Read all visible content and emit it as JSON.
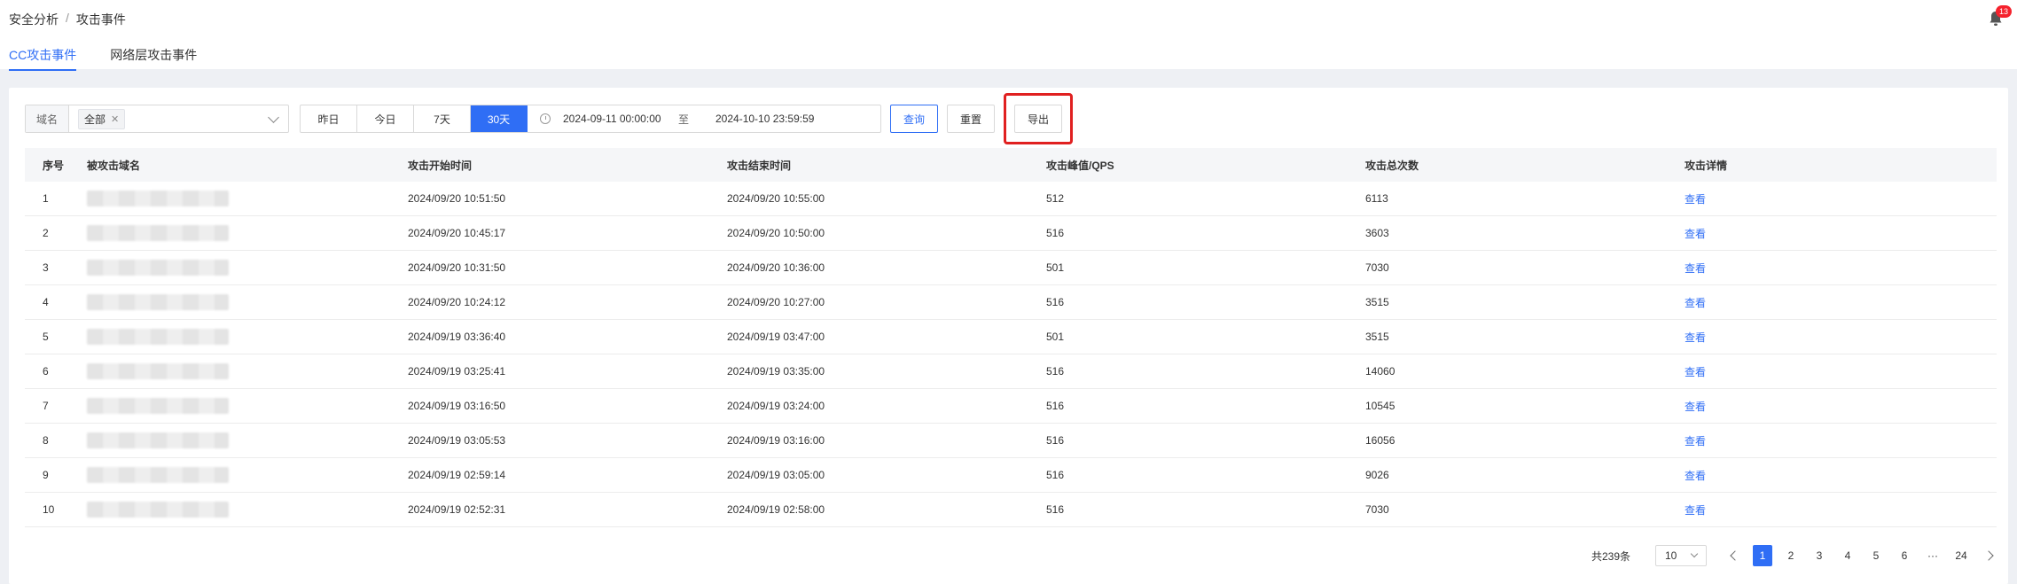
{
  "breadcrumb": {
    "parent": "安全分析",
    "separator": "/",
    "current": "攻击事件"
  },
  "notification": {
    "badge": "13"
  },
  "tabs": [
    {
      "label": "CC攻击事件",
      "active": true
    },
    {
      "label": "网络层攻击事件",
      "active": false
    }
  ],
  "filter": {
    "domain_label": "域名",
    "domain_tag": "全部",
    "range_buttons": [
      {
        "label": "昨日",
        "active": false
      },
      {
        "label": "今日",
        "active": false
      },
      {
        "label": "7天",
        "active": false
      },
      {
        "label": "30天",
        "active": true
      }
    ],
    "date_start": "2024-09-11 00:00:00",
    "date_sep": "至",
    "date_end": "2024-10-10 23:59:59",
    "query_label": "查询",
    "reset_label": "重置",
    "export_label": "导出"
  },
  "table": {
    "columns": [
      "序号",
      "被攻击域名",
      "攻击开始时间",
      "攻击结束时间",
      "攻击峰值/QPS",
      "攻击总次数",
      "攻击详情"
    ],
    "link_label": "查看",
    "rows": [
      {
        "no": "1",
        "start": "2024/09/20 10:51:50",
        "end": "2024/09/20 10:55:00",
        "peak": "512",
        "total": "6113"
      },
      {
        "no": "2",
        "start": "2024/09/20 10:45:17",
        "end": "2024/09/20 10:50:00",
        "peak": "516",
        "total": "3603"
      },
      {
        "no": "3",
        "start": "2024/09/20 10:31:50",
        "end": "2024/09/20 10:36:00",
        "peak": "501",
        "total": "7030"
      },
      {
        "no": "4",
        "start": "2024/09/20 10:24:12",
        "end": "2024/09/20 10:27:00",
        "peak": "516",
        "total": "3515"
      },
      {
        "no": "5",
        "start": "2024/09/19 03:36:40",
        "end": "2024/09/19 03:47:00",
        "peak": "501",
        "total": "3515"
      },
      {
        "no": "6",
        "start": "2024/09/19 03:25:41",
        "end": "2024/09/19 03:35:00",
        "peak": "516",
        "total": "14060"
      },
      {
        "no": "7",
        "start": "2024/09/19 03:16:50",
        "end": "2024/09/19 03:24:00",
        "peak": "516",
        "total": "10545"
      },
      {
        "no": "8",
        "start": "2024/09/19 03:05:53",
        "end": "2024/09/19 03:16:00",
        "peak": "516",
        "total": "16056"
      },
      {
        "no": "9",
        "start": "2024/09/19 02:59:14",
        "end": "2024/09/19 03:05:00",
        "peak": "516",
        "total": "9026"
      },
      {
        "no": "10",
        "start": "2024/09/19 02:52:31",
        "end": "2024/09/19 02:58:00",
        "peak": "516",
        "total": "7030"
      }
    ]
  },
  "pagination": {
    "total_text": "共239条",
    "page_size": "10",
    "pages": [
      "1",
      "2",
      "3",
      "4",
      "5",
      "6"
    ],
    "ellipsis": "···",
    "last_page": "24",
    "current": "1"
  }
}
